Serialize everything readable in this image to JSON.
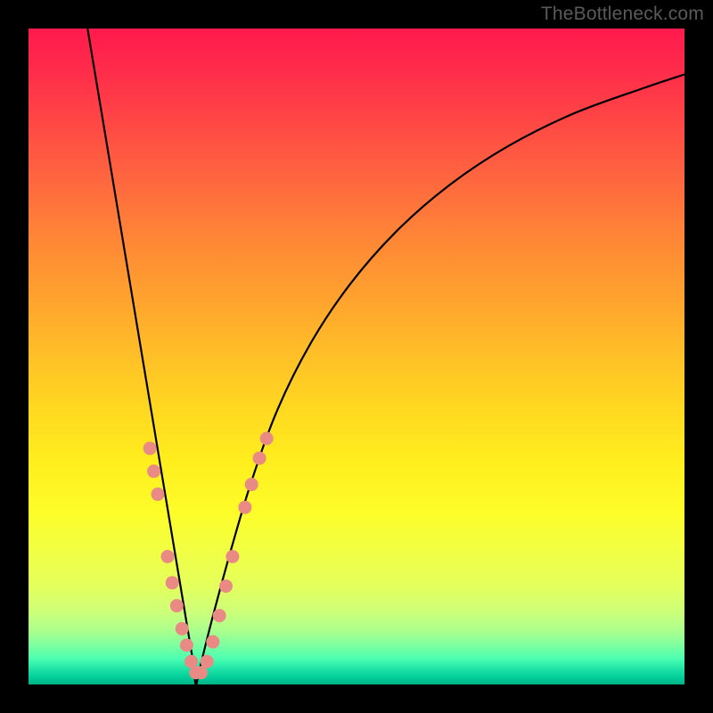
{
  "watermark": "TheBottleneck.com",
  "colors": {
    "frame": "#000000",
    "curve": "#000000",
    "marker_fill": "#e98a85",
    "marker_stroke": "#d87a75"
  },
  "chart_data": {
    "type": "line",
    "title": "",
    "xlabel": "",
    "ylabel": "",
    "xlim": [
      0,
      100
    ],
    "ylim": [
      0,
      100
    ],
    "grid": false,
    "legend": false,
    "x_min_curve": 9,
    "x_optimum": 25.5,
    "series": [
      {
        "name": "bottleneck-curve",
        "x": [
          9,
          11,
          13,
          15,
          17,
          19,
          21,
          23,
          25,
          25.5,
          26,
          28,
          31,
          34,
          38,
          43,
          49,
          56,
          64,
          73,
          83,
          94,
          100
        ],
        "values": [
          100,
          88,
          76,
          64,
          52,
          40,
          28,
          16,
          4,
          0,
          2,
          10,
          21,
          31,
          42,
          52,
          61,
          69,
          76,
          82,
          87,
          91,
          93
        ]
      }
    ],
    "markers": [
      {
        "x": 18.5,
        "y": 36.0
      },
      {
        "x": 19.1,
        "y": 32.5
      },
      {
        "x": 19.7,
        "y": 29.0
      },
      {
        "x": 21.2,
        "y": 19.5
      },
      {
        "x": 21.9,
        "y": 15.5
      },
      {
        "x": 22.6,
        "y": 12.0
      },
      {
        "x": 23.4,
        "y": 8.5
      },
      {
        "x": 24.1,
        "y": 6.0
      },
      {
        "x": 24.8,
        "y": 3.5
      },
      {
        "x": 25.5,
        "y": 1.8
      },
      {
        "x": 26.3,
        "y": 1.8
      },
      {
        "x": 27.2,
        "y": 3.5
      },
      {
        "x": 28.1,
        "y": 6.5
      },
      {
        "x": 29.1,
        "y": 10.5
      },
      {
        "x": 30.1,
        "y": 15.0
      },
      {
        "x": 31.1,
        "y": 19.5
      },
      {
        "x": 33.0,
        "y": 27.0
      },
      {
        "x": 34.0,
        "y": 30.5
      },
      {
        "x": 35.2,
        "y": 34.5
      },
      {
        "x": 36.3,
        "y": 37.5
      }
    ]
  }
}
